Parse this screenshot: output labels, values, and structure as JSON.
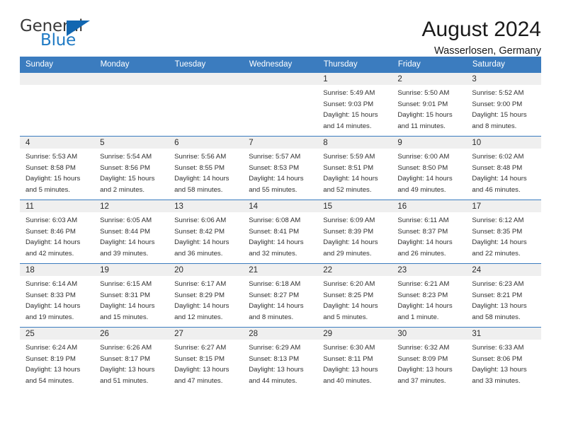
{
  "brand": {
    "name_part1": "General",
    "name_part2": "Blue",
    "flag_icon": "blue-triangle-flag",
    "colors": {
      "general_text": "#3a3a3a",
      "blue_text": "#1f7ac4",
      "flag": "#1267b1",
      "header_bar": "#3b7cbf",
      "daynum_band": "#efefef"
    }
  },
  "header": {
    "title": "August 2024",
    "subtitle": "Wasserlosen, Germany"
  },
  "weekdays": [
    "Sunday",
    "Monday",
    "Tuesday",
    "Wednesday",
    "Thursday",
    "Friday",
    "Saturday"
  ],
  "weeks": [
    [
      {
        "day": "",
        "empty": true,
        "sunrise": "",
        "sunset": "",
        "daylight1": "",
        "daylight2": ""
      },
      {
        "day": "",
        "empty": true,
        "sunrise": "",
        "sunset": "",
        "daylight1": "",
        "daylight2": ""
      },
      {
        "day": "",
        "empty": true,
        "sunrise": "",
        "sunset": "",
        "daylight1": "",
        "daylight2": ""
      },
      {
        "day": "",
        "empty": true,
        "sunrise": "",
        "sunset": "",
        "daylight1": "",
        "daylight2": ""
      },
      {
        "day": "1",
        "empty": false,
        "sunrise": "Sunrise: 5:49 AM",
        "sunset": "Sunset: 9:03 PM",
        "daylight1": "Daylight: 15 hours",
        "daylight2": "and 14 minutes."
      },
      {
        "day": "2",
        "empty": false,
        "sunrise": "Sunrise: 5:50 AM",
        "sunset": "Sunset: 9:01 PM",
        "daylight1": "Daylight: 15 hours",
        "daylight2": "and 11 minutes."
      },
      {
        "day": "3",
        "empty": false,
        "sunrise": "Sunrise: 5:52 AM",
        "sunset": "Sunset: 9:00 PM",
        "daylight1": "Daylight: 15 hours",
        "daylight2": "and 8 minutes."
      }
    ],
    [
      {
        "day": "4",
        "empty": false,
        "sunrise": "Sunrise: 5:53 AM",
        "sunset": "Sunset: 8:58 PM",
        "daylight1": "Daylight: 15 hours",
        "daylight2": "and 5 minutes."
      },
      {
        "day": "5",
        "empty": false,
        "sunrise": "Sunrise: 5:54 AM",
        "sunset": "Sunset: 8:56 PM",
        "daylight1": "Daylight: 15 hours",
        "daylight2": "and 2 minutes."
      },
      {
        "day": "6",
        "empty": false,
        "sunrise": "Sunrise: 5:56 AM",
        "sunset": "Sunset: 8:55 PM",
        "daylight1": "Daylight: 14 hours",
        "daylight2": "and 58 minutes."
      },
      {
        "day": "7",
        "empty": false,
        "sunrise": "Sunrise: 5:57 AM",
        "sunset": "Sunset: 8:53 PM",
        "daylight1": "Daylight: 14 hours",
        "daylight2": "and 55 minutes."
      },
      {
        "day": "8",
        "empty": false,
        "sunrise": "Sunrise: 5:59 AM",
        "sunset": "Sunset: 8:51 PM",
        "daylight1": "Daylight: 14 hours",
        "daylight2": "and 52 minutes."
      },
      {
        "day": "9",
        "empty": false,
        "sunrise": "Sunrise: 6:00 AM",
        "sunset": "Sunset: 8:50 PM",
        "daylight1": "Daylight: 14 hours",
        "daylight2": "and 49 minutes."
      },
      {
        "day": "10",
        "empty": false,
        "sunrise": "Sunrise: 6:02 AM",
        "sunset": "Sunset: 8:48 PM",
        "daylight1": "Daylight: 14 hours",
        "daylight2": "and 46 minutes."
      }
    ],
    [
      {
        "day": "11",
        "empty": false,
        "sunrise": "Sunrise: 6:03 AM",
        "sunset": "Sunset: 8:46 PM",
        "daylight1": "Daylight: 14 hours",
        "daylight2": "and 42 minutes."
      },
      {
        "day": "12",
        "empty": false,
        "sunrise": "Sunrise: 6:05 AM",
        "sunset": "Sunset: 8:44 PM",
        "daylight1": "Daylight: 14 hours",
        "daylight2": "and 39 minutes."
      },
      {
        "day": "13",
        "empty": false,
        "sunrise": "Sunrise: 6:06 AM",
        "sunset": "Sunset: 8:42 PM",
        "daylight1": "Daylight: 14 hours",
        "daylight2": "and 36 minutes."
      },
      {
        "day": "14",
        "empty": false,
        "sunrise": "Sunrise: 6:08 AM",
        "sunset": "Sunset: 8:41 PM",
        "daylight1": "Daylight: 14 hours",
        "daylight2": "and 32 minutes."
      },
      {
        "day": "15",
        "empty": false,
        "sunrise": "Sunrise: 6:09 AM",
        "sunset": "Sunset: 8:39 PM",
        "daylight1": "Daylight: 14 hours",
        "daylight2": "and 29 minutes."
      },
      {
        "day": "16",
        "empty": false,
        "sunrise": "Sunrise: 6:11 AM",
        "sunset": "Sunset: 8:37 PM",
        "daylight1": "Daylight: 14 hours",
        "daylight2": "and 26 minutes."
      },
      {
        "day": "17",
        "empty": false,
        "sunrise": "Sunrise: 6:12 AM",
        "sunset": "Sunset: 8:35 PM",
        "daylight1": "Daylight: 14 hours",
        "daylight2": "and 22 minutes."
      }
    ],
    [
      {
        "day": "18",
        "empty": false,
        "sunrise": "Sunrise: 6:14 AM",
        "sunset": "Sunset: 8:33 PM",
        "daylight1": "Daylight: 14 hours",
        "daylight2": "and 19 minutes."
      },
      {
        "day": "19",
        "empty": false,
        "sunrise": "Sunrise: 6:15 AM",
        "sunset": "Sunset: 8:31 PM",
        "daylight1": "Daylight: 14 hours",
        "daylight2": "and 15 minutes."
      },
      {
        "day": "20",
        "empty": false,
        "sunrise": "Sunrise: 6:17 AM",
        "sunset": "Sunset: 8:29 PM",
        "daylight1": "Daylight: 14 hours",
        "daylight2": "and 12 minutes."
      },
      {
        "day": "21",
        "empty": false,
        "sunrise": "Sunrise: 6:18 AM",
        "sunset": "Sunset: 8:27 PM",
        "daylight1": "Daylight: 14 hours",
        "daylight2": "and 8 minutes."
      },
      {
        "day": "22",
        "empty": false,
        "sunrise": "Sunrise: 6:20 AM",
        "sunset": "Sunset: 8:25 PM",
        "daylight1": "Daylight: 14 hours",
        "daylight2": "and 5 minutes."
      },
      {
        "day": "23",
        "empty": false,
        "sunrise": "Sunrise: 6:21 AM",
        "sunset": "Sunset: 8:23 PM",
        "daylight1": "Daylight: 14 hours",
        "daylight2": "and 1 minute."
      },
      {
        "day": "24",
        "empty": false,
        "sunrise": "Sunrise: 6:23 AM",
        "sunset": "Sunset: 8:21 PM",
        "daylight1": "Daylight: 13 hours",
        "daylight2": "and 58 minutes."
      }
    ],
    [
      {
        "day": "25",
        "empty": false,
        "sunrise": "Sunrise: 6:24 AM",
        "sunset": "Sunset: 8:19 PM",
        "daylight1": "Daylight: 13 hours",
        "daylight2": "and 54 minutes."
      },
      {
        "day": "26",
        "empty": false,
        "sunrise": "Sunrise: 6:26 AM",
        "sunset": "Sunset: 8:17 PM",
        "daylight1": "Daylight: 13 hours",
        "daylight2": "and 51 minutes."
      },
      {
        "day": "27",
        "empty": false,
        "sunrise": "Sunrise: 6:27 AM",
        "sunset": "Sunset: 8:15 PM",
        "daylight1": "Daylight: 13 hours",
        "daylight2": "and 47 minutes."
      },
      {
        "day": "28",
        "empty": false,
        "sunrise": "Sunrise: 6:29 AM",
        "sunset": "Sunset: 8:13 PM",
        "daylight1": "Daylight: 13 hours",
        "daylight2": "and 44 minutes."
      },
      {
        "day": "29",
        "empty": false,
        "sunrise": "Sunrise: 6:30 AM",
        "sunset": "Sunset: 8:11 PM",
        "daylight1": "Daylight: 13 hours",
        "daylight2": "and 40 minutes."
      },
      {
        "day": "30",
        "empty": false,
        "sunrise": "Sunrise: 6:32 AM",
        "sunset": "Sunset: 8:09 PM",
        "daylight1": "Daylight: 13 hours",
        "daylight2": "and 37 minutes."
      },
      {
        "day": "31",
        "empty": false,
        "sunrise": "Sunrise: 6:33 AM",
        "sunset": "Sunset: 8:06 PM",
        "daylight1": "Daylight: 13 hours",
        "daylight2": "and 33 minutes."
      }
    ]
  ]
}
